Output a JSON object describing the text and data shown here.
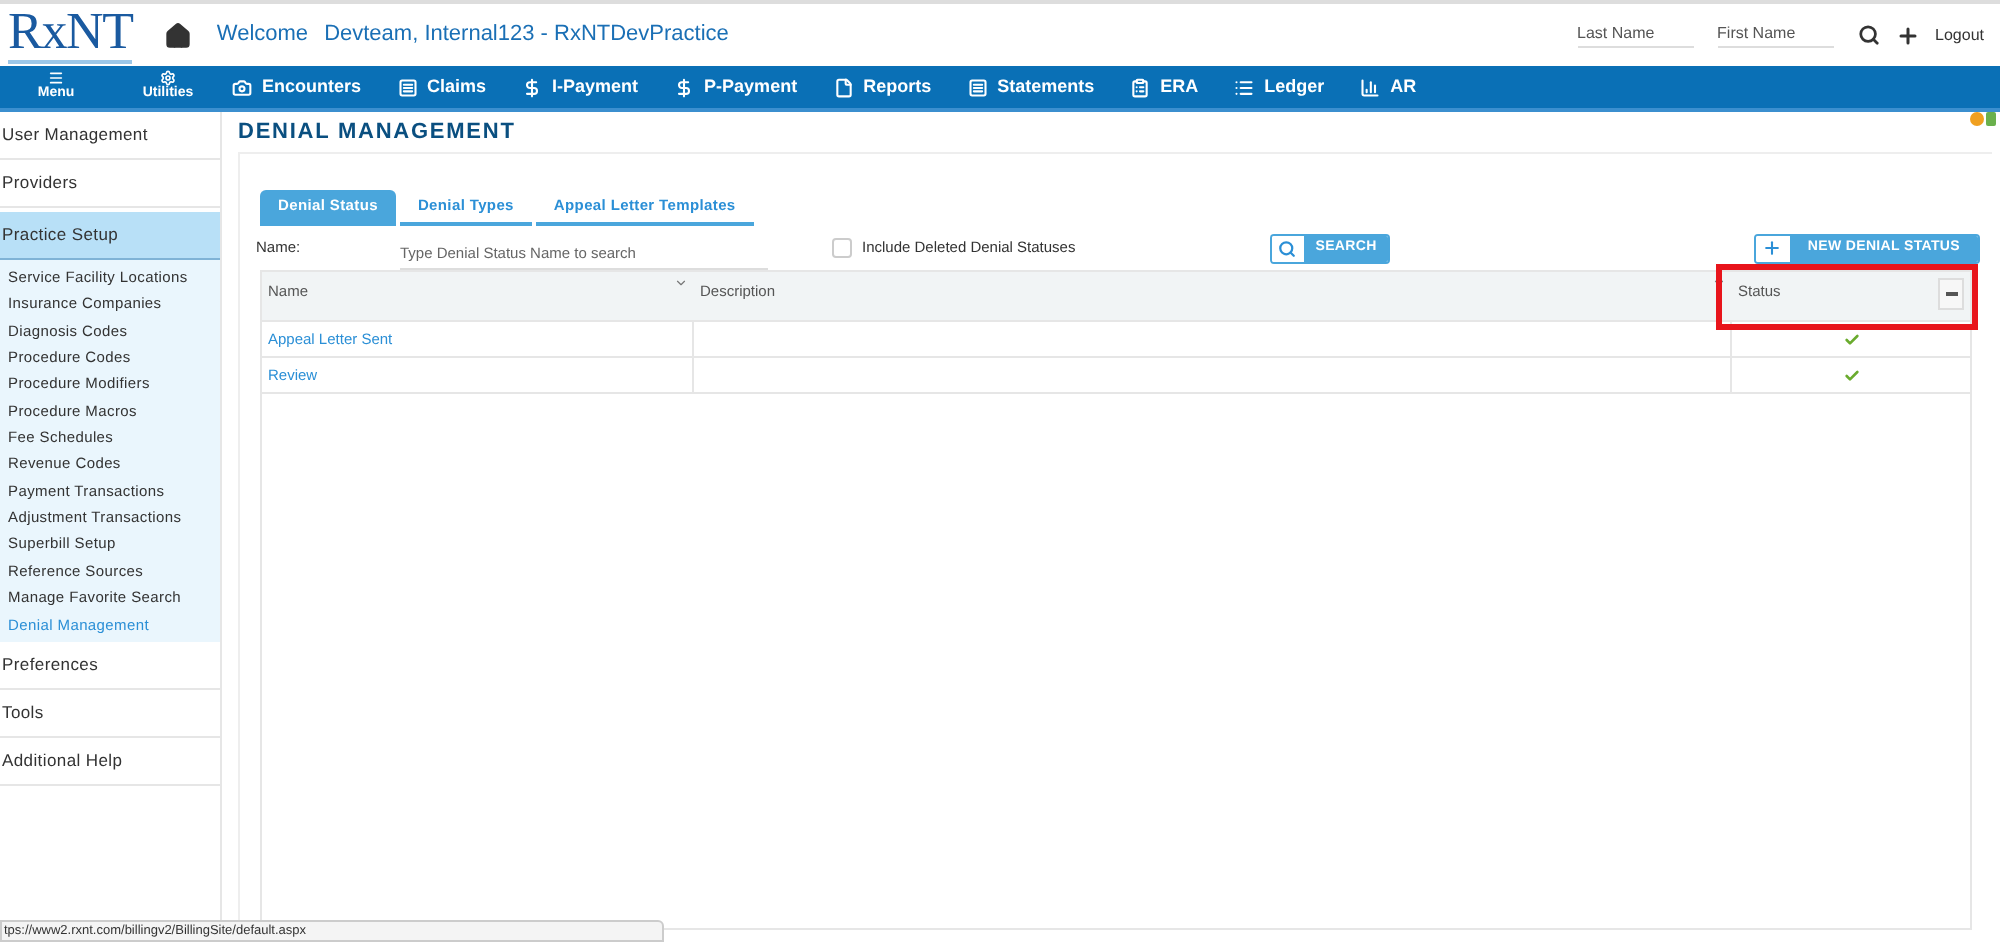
{
  "header": {
    "logo": "RxNT",
    "welcome": "Welcome",
    "user": "Devteam, Internal123 - RxNTDevPractice",
    "last_name": {
      "placeholder": "Last Name"
    },
    "first_name": {
      "placeholder": "First Name"
    },
    "logout": "Logout"
  },
  "nav": {
    "left": [
      {
        "label": "Menu"
      },
      {
        "label": "Utilities"
      }
    ],
    "items": [
      {
        "label": "Encounters"
      },
      {
        "label": "Claims"
      },
      {
        "label": "I-Payment"
      },
      {
        "label": "P-Payment"
      },
      {
        "label": "Reports"
      },
      {
        "label": "Statements"
      },
      {
        "label": "ERA"
      },
      {
        "label": "Ledger"
      },
      {
        "label": "AR"
      }
    ]
  },
  "sidebar": {
    "items": [
      {
        "label": "User Management",
        "selected": false
      },
      {
        "label": "Providers",
        "selected": false
      },
      {
        "label": "Practice Setup",
        "selected": true,
        "children": [
          {
            "label": "Service Facility Locations",
            "selected": false
          },
          {
            "label": "Insurance Companies",
            "selected": false
          },
          {
            "label": "Diagnosis Codes",
            "selected": false
          },
          {
            "label": "Procedure Codes",
            "selected": false
          },
          {
            "label": "Procedure Modifiers",
            "selected": false
          },
          {
            "label": "Procedure Macros",
            "selected": false
          },
          {
            "label": "Fee Schedules",
            "selected": false
          },
          {
            "label": "Revenue Codes",
            "selected": false
          },
          {
            "label": "Payment Transactions",
            "selected": false
          },
          {
            "label": "Adjustment Transactions",
            "selected": false
          },
          {
            "label": "Superbill Setup",
            "selected": false
          },
          {
            "label": "Reference Sources",
            "selected": false
          },
          {
            "label": "Manage Favorite Search",
            "selected": false
          },
          {
            "label": "Denial Management",
            "selected": true
          }
        ]
      },
      {
        "label": "Preferences",
        "selected": false
      },
      {
        "label": "Tools",
        "selected": false
      },
      {
        "label": "Additional Help",
        "selected": false
      }
    ]
  },
  "page_title": "DENIAL MANAGEMENT",
  "tabs": [
    {
      "label": "Denial Status",
      "selected": true
    },
    {
      "label": "Denial Types",
      "selected": false
    },
    {
      "label": "Appeal Letter Templates",
      "selected": false
    }
  ],
  "filter": {
    "label": "Name:",
    "placeholder": "Type Denial Status Name to search",
    "include_deleted": {
      "label": "Include Deleted Denial Statuses",
      "checked": false
    },
    "search_button": "SEARCH"
  },
  "new_button": "NEW DENIAL STATUS",
  "table": {
    "columns": [
      "Name",
      "Description",
      "Status"
    ],
    "rows": [
      {
        "name": "Appeal Letter Sent",
        "active": true
      },
      {
        "name": "Review",
        "active": true
      }
    ]
  },
  "status_url": "tps://www2.rxnt.com/billingv2/BillingSite/default.aspx"
}
